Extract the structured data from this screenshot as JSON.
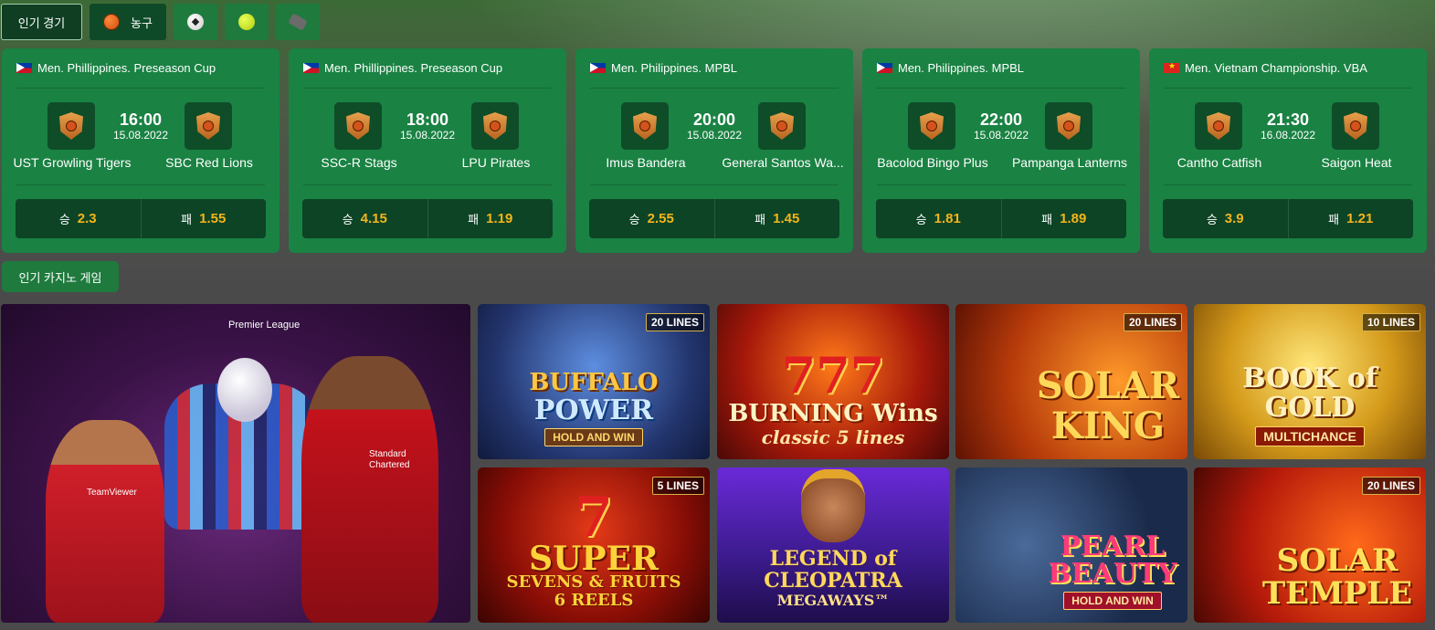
{
  "tabs": {
    "popular_label": "인기 경기",
    "basketball_label": "농구"
  },
  "matches": [
    {
      "league": "Men. Phillippines. Preseason Cup",
      "flag": "ph",
      "time": "16:00",
      "date": "15.08.2022",
      "home": "UST Growling Tigers",
      "away": "SBC Red Lions",
      "win_label": "승",
      "win_odds": "2.3",
      "lose_label": "패",
      "lose_odds": "1.55"
    },
    {
      "league": "Men. Phillippines. Preseason Cup",
      "flag": "ph",
      "time": "18:00",
      "date": "15.08.2022",
      "home": "SSC-R Stags",
      "away": "LPU Pirates",
      "win_label": "승",
      "win_odds": "4.15",
      "lose_label": "패",
      "lose_odds": "1.19"
    },
    {
      "league": "Men. Philippines. MPBL",
      "flag": "ph",
      "time": "20:00",
      "date": "15.08.2022",
      "home": "Imus Bandera",
      "away": "General Santos Wa...",
      "win_label": "승",
      "win_odds": "2.55",
      "lose_label": "패",
      "lose_odds": "1.45"
    },
    {
      "league": "Men. Philippines. MPBL",
      "flag": "ph",
      "time": "22:00",
      "date": "15.08.2022",
      "home": "Bacolod Bingo Plus",
      "away": "Pampanga Lanterns",
      "win_label": "승",
      "win_odds": "1.81",
      "lose_label": "패",
      "lose_odds": "1.89"
    },
    {
      "league": "Men. Vietnam Championship. VBA",
      "flag": "vn",
      "time": "21:30",
      "date": "16.08.2022",
      "home": "Cantho Catfish",
      "away": "Saigon Heat",
      "win_label": "승",
      "win_odds": "3.9",
      "lose_label": "패",
      "lose_odds": "1.21"
    }
  ],
  "casino": {
    "tab_label": "인기 카지노 게임",
    "banner": {
      "league_name": "Premier League",
      "sponsor_1": "TeamViewer",
      "sponsor_2": "Standard Chartered"
    },
    "games": [
      {
        "lines": "20 LINES",
        "title_1": "BUFFALO",
        "title_2": "POWER",
        "badge": "HOLD AND WIN"
      },
      {
        "lines": "",
        "title_1": "777",
        "title_2": "BURNING Wins",
        "badge": "classic 5 lines"
      },
      {
        "lines": "20 LINES",
        "title_1": "SOLAR",
        "title_2": "KING",
        "badge": ""
      },
      {
        "lines": "10 LINES",
        "title_1": "BOOK of GOLD",
        "title_2": "",
        "badge": "MULTICHANCE"
      },
      {
        "lines": "5 LINES",
        "title_1": "SUPER",
        "title_2": "SEVENS & FRUITS",
        "badge": "6 REELS"
      },
      {
        "lines": "",
        "title_1": "LEGEND of CLEOPATRA",
        "title_2": "MEGAWAYS™",
        "badge": ""
      },
      {
        "lines": "",
        "title_1": "PEARL BEAUTY",
        "title_2": "",
        "badge": "HOLD AND WIN"
      },
      {
        "lines": "20 LINES",
        "title_1": "SOLAR TEMPLE",
        "title_2": "",
        "badge": ""
      }
    ]
  },
  "colors": {
    "card_bg": "#1a8243",
    "odds_bg": "#0d4426",
    "odds_value": "#f5b41a",
    "page_bg": "#4a4a4a"
  },
  "icons": [
    "basketball-icon",
    "soccer-ball-icon",
    "tennis-ball-icon",
    "hockey-puck-icon",
    "philippines-flag-icon",
    "vietnam-flag-icon",
    "team-shield-icon"
  ]
}
